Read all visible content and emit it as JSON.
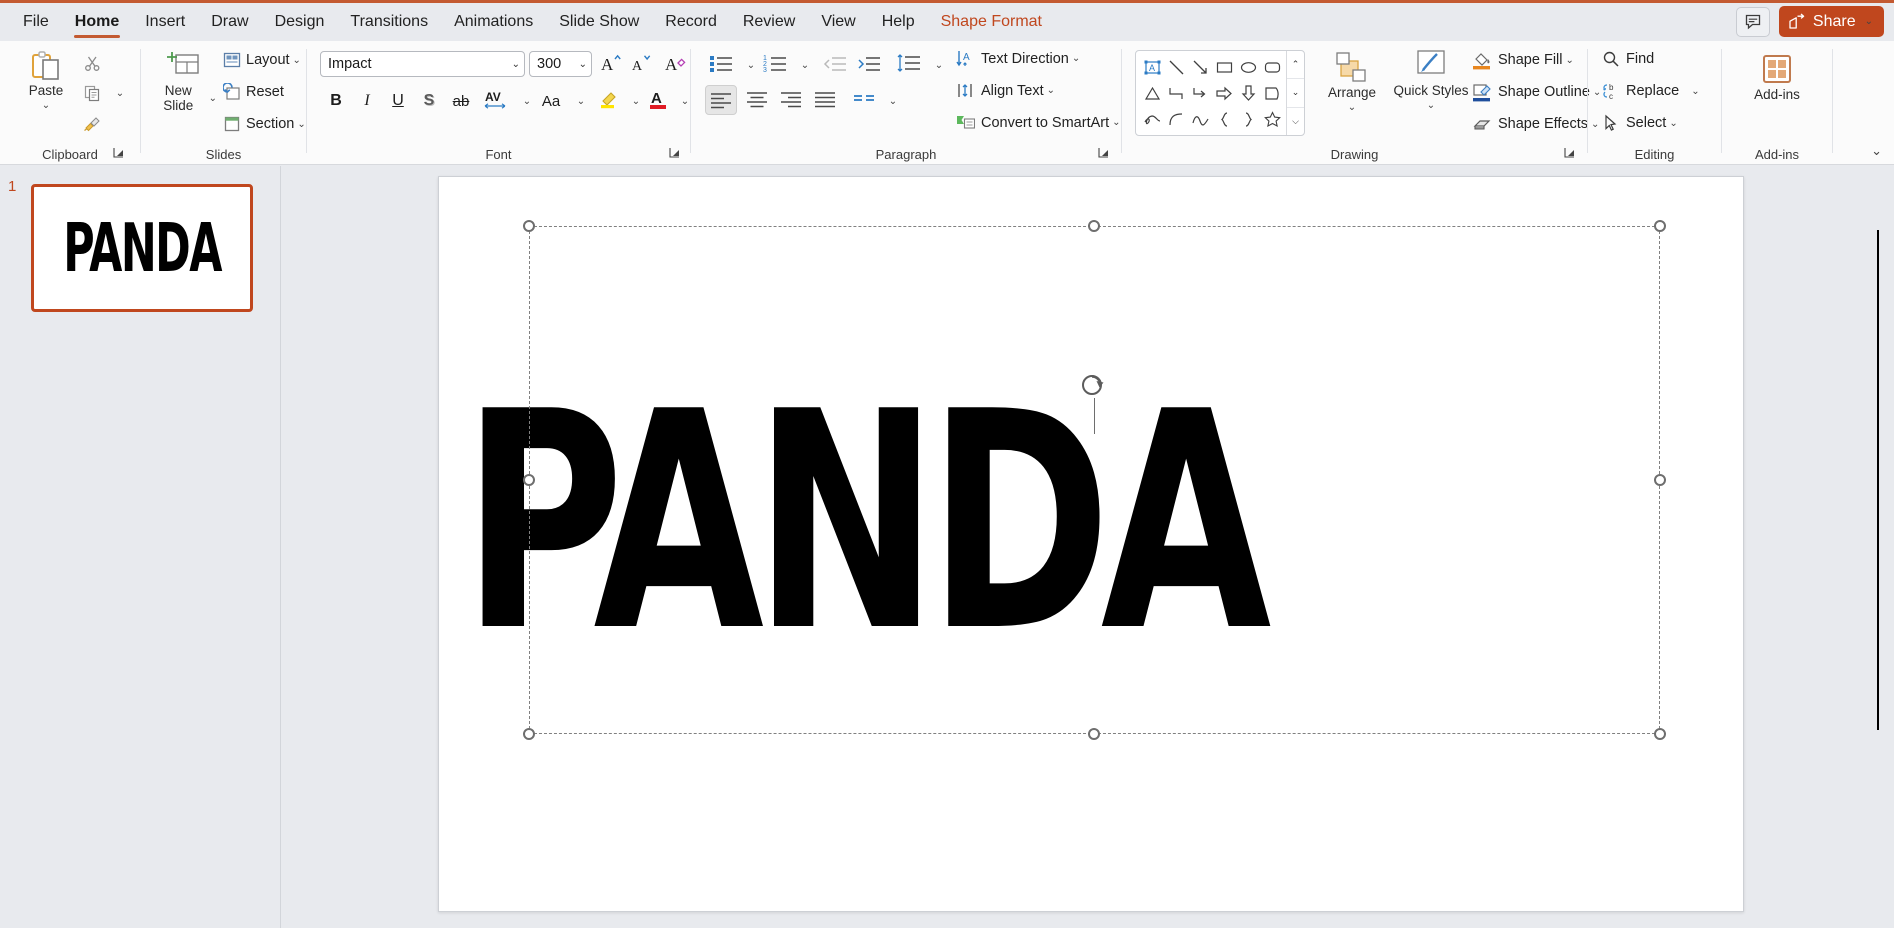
{
  "app": {
    "name": "PowerPoint",
    "accent_color": "#c0471e",
    "ribbon_bg": "#fbfbfb",
    "chrome_bg": "#e8eaee"
  },
  "titlebar": {
    "tabs": [
      {
        "label": "File",
        "active": false,
        "contextual": false
      },
      {
        "label": "Home",
        "active": true,
        "contextual": false
      },
      {
        "label": "Insert",
        "active": false,
        "contextual": false
      },
      {
        "label": "Draw",
        "active": false,
        "contextual": false
      },
      {
        "label": "Design",
        "active": false,
        "contextual": false
      },
      {
        "label": "Transitions",
        "active": false,
        "contextual": false
      },
      {
        "label": "Animations",
        "active": false,
        "contextual": false
      },
      {
        "label": "Slide Show",
        "active": false,
        "contextual": false
      },
      {
        "label": "Record",
        "active": false,
        "contextual": false
      },
      {
        "label": "Review",
        "active": false,
        "contextual": false
      },
      {
        "label": "View",
        "active": false,
        "contextual": false
      },
      {
        "label": "Help",
        "active": false,
        "contextual": false
      },
      {
        "label": "Shape Format",
        "active": false,
        "contextual": true
      }
    ],
    "comments_icon": "comment-icon",
    "share_label": "Share",
    "share_icon": "share-icon",
    "share_caret": "⌄"
  },
  "ribbon": {
    "collapse_chevron": "⌄",
    "groups": [
      {
        "name": "Clipboard",
        "label": "Clipboard",
        "has_launcher": true,
        "items": [
          {
            "name": "paste-button",
            "label": "Paste",
            "icon": "clipboard-icon",
            "caret": "⌄"
          },
          {
            "name": "cut-button",
            "label": "",
            "icon": "scissors-icon"
          },
          {
            "name": "copy-button",
            "label": "",
            "icon": "copy-icon",
            "caret": "⌄"
          },
          {
            "name": "format-painter-button",
            "label": "",
            "icon": "format-painter-icon"
          }
        ]
      },
      {
        "name": "Slides",
        "label": "Slides",
        "has_launcher": false,
        "items": [
          {
            "name": "new-slide-button",
            "label": "New Slide",
            "icon": "new-slide-icon",
            "caret": "⌄"
          },
          {
            "name": "layout-button",
            "label": "Layout",
            "icon": "layout-icon",
            "caret": "⌄"
          },
          {
            "name": "reset-button",
            "label": "Reset",
            "icon": "reset-icon"
          },
          {
            "name": "section-button",
            "label": "Section",
            "icon": "section-icon",
            "caret": "⌄"
          }
        ]
      },
      {
        "name": "Font",
        "label": "Font",
        "has_launcher": true,
        "font_name_value": "Impact",
        "font_name_placeholder": "Font",
        "font_size_value": "300",
        "font_size_placeholder": "Size",
        "items": [
          {
            "name": "increase-font-size-button",
            "label": "A",
            "icon": "increase-font-icon"
          },
          {
            "name": "decrease-font-size-button",
            "label": "A",
            "icon": "decrease-font-icon"
          },
          {
            "name": "clear-formatting-button",
            "label": "A",
            "icon": "clear-formatting-icon"
          },
          {
            "name": "bold-button",
            "label": "B",
            "icon": "bold-icon"
          },
          {
            "name": "italic-button",
            "label": "I",
            "icon": "italic-icon"
          },
          {
            "name": "underline-button",
            "label": "U",
            "icon": "underline-icon"
          },
          {
            "name": "text-shadow-button",
            "label": "S",
            "icon": "text-shadow-icon"
          },
          {
            "name": "strikethrough-button",
            "label": "ab",
            "icon": "strikethrough-icon"
          },
          {
            "name": "character-spacing-button",
            "label": "AV",
            "icon": "character-spacing-icon",
            "caret": "⌄"
          },
          {
            "name": "change-case-button",
            "label": "Aa",
            "icon": "change-case-icon",
            "caret": "⌄"
          },
          {
            "name": "text-highlight-color-button",
            "label": "",
            "icon": "highlighter-icon",
            "caret": "⌄",
            "color": "#ffe400"
          },
          {
            "name": "font-color-button",
            "label": "A",
            "icon": "font-color-icon",
            "caret": "⌄",
            "color": "#e01b24"
          }
        ]
      },
      {
        "name": "Paragraph",
        "label": "Paragraph",
        "has_launcher": true,
        "items": [
          {
            "name": "bullets-button",
            "label": "",
            "icon": "bullets-icon",
            "caret": "⌄"
          },
          {
            "name": "numbering-button",
            "label": "",
            "icon": "numbering-icon",
            "caret": "⌄"
          },
          {
            "name": "decrease-indent-button",
            "label": "",
            "icon": "decrease-indent-icon"
          },
          {
            "name": "increase-indent-button",
            "label": "",
            "icon": "increase-indent-icon"
          },
          {
            "name": "line-spacing-button",
            "label": "",
            "icon": "line-spacing-icon",
            "caret": "⌄"
          },
          {
            "name": "align-left-button",
            "label": "",
            "icon": "align-left-icon",
            "selected": true
          },
          {
            "name": "align-center-button",
            "label": "",
            "icon": "align-center-icon"
          },
          {
            "name": "align-right-button",
            "label": "",
            "icon": "align-right-icon"
          },
          {
            "name": "justify-button",
            "label": "",
            "icon": "justify-icon"
          },
          {
            "name": "columns-button",
            "label": "",
            "icon": "columns-icon",
            "caret": "⌄"
          },
          {
            "name": "text-direction-button",
            "label": "Text Direction",
            "icon": "text-direction-icon",
            "caret": "⌄"
          },
          {
            "name": "align-text-button",
            "label": "Align Text",
            "icon": "align-text-icon",
            "caret": "⌄"
          },
          {
            "name": "convert-to-smartart-button",
            "label": "Convert to SmartArt",
            "icon": "smartart-icon",
            "caret": "⌄"
          }
        ]
      },
      {
        "name": "Drawing",
        "label": "Drawing",
        "has_launcher": true,
        "shapes": [
          "textbox-shape-icon",
          "line-shape-icon",
          "arrow-shape-icon",
          "rectangle-shape-icon",
          "oval-shape-icon",
          "rounded-rectangle-shape-icon",
          "triangle-shape-icon",
          "elbow-connector-shape-icon",
          "elbow-arrow-connector-shape-icon",
          "right-arrow-shape-icon",
          "down-arrow-shape-icon",
          "flowchart-shape-icon",
          "scribble-shape-icon",
          "curve-shape-icon",
          "freeform-shape-icon",
          "left-brace-shape-icon",
          "right-brace-shape-icon",
          "star-shape-icon"
        ],
        "scroll_up": "⌃",
        "scroll_down": "⌄",
        "scroll_more": "⌵",
        "items": [
          {
            "name": "arrange-button",
            "label": "Arrange",
            "icon": "arrange-icon",
            "caret": "⌄"
          },
          {
            "name": "quick-styles-button",
            "label": "Quick Styles",
            "icon": "quick-styles-icon",
            "caret": "⌄"
          },
          {
            "name": "shape-fill-button",
            "label": "Shape Fill",
            "icon": "shape-fill-icon",
            "caret": "⌄",
            "color": "#e8861e"
          },
          {
            "name": "shape-outline-button",
            "label": "Shape Outline",
            "icon": "shape-outline-icon",
            "caret": "⌄",
            "color": "#1f4e9c"
          },
          {
            "name": "shape-effects-button",
            "label": "Shape Effects",
            "icon": "shape-effects-icon",
            "caret": "⌄"
          }
        ]
      },
      {
        "name": "Editing",
        "label": "Editing",
        "has_launcher": false,
        "items": [
          {
            "name": "find-button",
            "label": "Find",
            "icon": "search-icon"
          },
          {
            "name": "replace-button",
            "label": "Replace",
            "icon": "replace-icon",
            "caret": "⌄"
          },
          {
            "name": "select-button",
            "label": "Select",
            "icon": "select-cursor-icon",
            "caret": "⌄"
          }
        ]
      },
      {
        "name": "Add-ins",
        "label": "Add-ins",
        "has_launcher": false,
        "items": [
          {
            "name": "add-ins-button",
            "label": "Add-ins",
            "icon": "add-ins-icon"
          }
        ]
      }
    ]
  },
  "thumbnails": {
    "slides": [
      {
        "number": "1",
        "text": "PANDA",
        "selected": true
      }
    ]
  },
  "slide": {
    "text": "PANDA",
    "font": "Impact",
    "font_size": "300",
    "text_color": "#000000",
    "background": "#ffffff",
    "selection": {
      "rotation_handle": "rotate-handle-icon",
      "handle_count": 8,
      "caret_visible": true
    }
  }
}
